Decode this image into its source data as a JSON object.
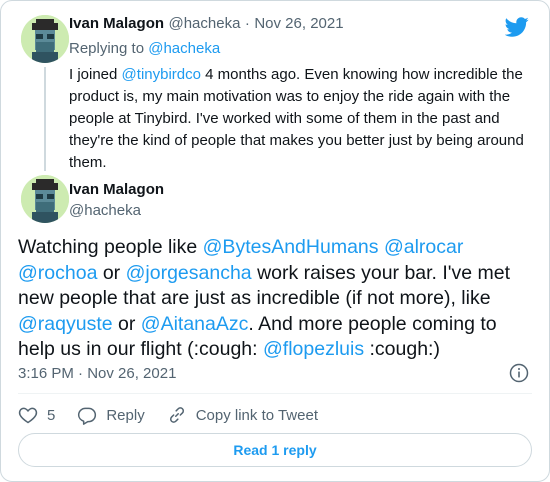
{
  "reply": {
    "author_name": "Ivan Malagon",
    "author_handle": "@hacheka",
    "separator": "·",
    "date": "Nov 26, 2021",
    "replying_prefix": "Replying to",
    "replying_to": "@hacheka",
    "text_before": "I joined ",
    "mention": "@tinybirdco",
    "text_after": " 4 months ago. Even knowing how incredible the product is, my main motivation was to enjoy the ride again with the people at Tinybird. I've worked with some of them in the past and they're the kind of people that makes you better just by being around them."
  },
  "tweet": {
    "author_name": "Ivan Malagon",
    "author_handle": "@hacheka",
    "t1": "Watching people like ",
    "m1": "@BytesAndHumans",
    "t2": "  ",
    "m2": "@alrocar",
    "t3": " ",
    "m3": "@rochoa",
    "t4": "  or ",
    "m4": "@jorgesancha",
    "t5": "  work raises your bar. I've met new people that are just as incredible (if not more), like ",
    "m5": "@raqyuste",
    "t6": " or ",
    "m6": "@AitanaAzc",
    "t7": ". And more people coming to help us in our flight (:cough: ",
    "m7": "@flopezluis",
    "t8": " :cough:)",
    "timestamp": "3:16 PM · Nov 26, 2021"
  },
  "actions": {
    "like_count": "5",
    "reply_label": "Reply",
    "copy_label": "Copy link to Tweet"
  },
  "read_replies_label": "Read 1 reply",
  "colors": {
    "accent": "#1d9bf0",
    "secondary_text": "#536471",
    "avatar_bg": "#cdebb1"
  },
  "icons": [
    "twitter-bird-icon",
    "info-icon",
    "heart-icon",
    "reply-icon",
    "link-icon"
  ]
}
